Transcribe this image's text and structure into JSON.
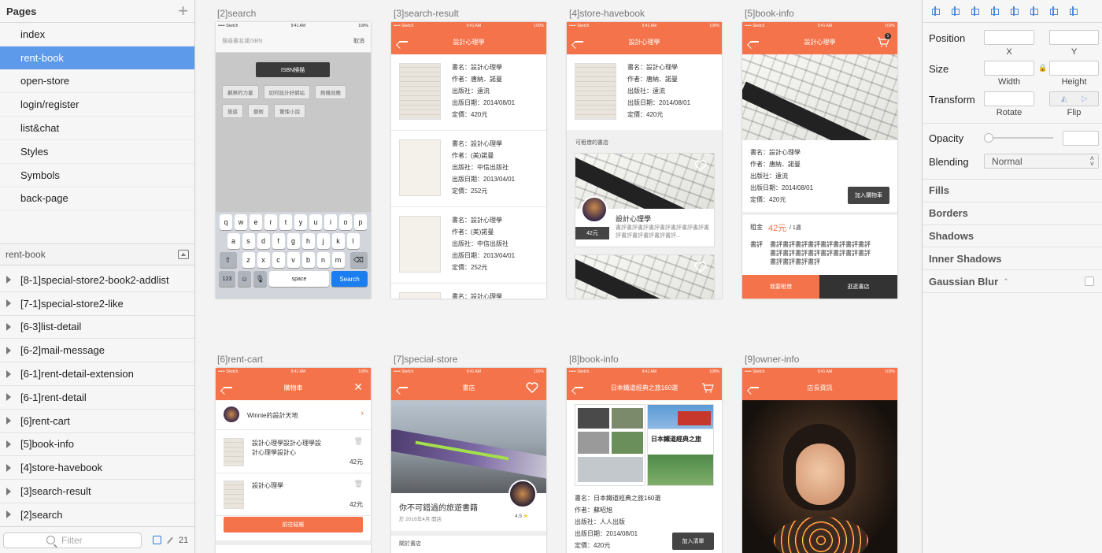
{
  "left": {
    "pages_title": "Pages",
    "pages": [
      "index",
      "rent-book",
      "open-store",
      "login/register",
      "list&chat",
      "Styles",
      "Symbols",
      "back-page"
    ],
    "selected_page": 1,
    "layer_header": "rent-book",
    "layers": [
      "[8-1]special-store2-book2-addlist",
      "[7-1]special-store2-like",
      "[6-3]list-detail",
      "[6-2]mail-message",
      "[6-1]rent-detail-extension",
      "[6-1]rent-detail",
      "[6]rent-cart",
      "[5]book-info",
      "[4]store-havebook",
      "[3]search-result",
      "[2]search"
    ],
    "filter_placeholder": "Filter",
    "count": "21"
  },
  "artboards": {
    "search": {
      "label": "[2]search",
      "status": [
        "•••••  Sketch",
        "9:41 AM",
        "100%"
      ],
      "placeholder": "搜尋書名或ISBN",
      "cancel": "取消",
      "isbn_btn": "ISBN掃描",
      "tags": [
        "觀察的力量",
        "如何設計好網站",
        "夠機效應",
        "旅遊",
        "藝術",
        "驚悚小說"
      ],
      "keys_row1": [
        "q",
        "w",
        "e",
        "r",
        "t",
        "y",
        "u",
        "i",
        "o",
        "p"
      ],
      "keys_row2": [
        "a",
        "s",
        "d",
        "f",
        "g",
        "h",
        "j",
        "k",
        "l"
      ],
      "keys_row3": [
        "z",
        "x",
        "c",
        "v",
        "b",
        "n",
        "m"
      ],
      "key_123": "123",
      "key_space": "space",
      "key_search": "Search"
    },
    "search_result": {
      "label": "[3]search-result",
      "status": [
        "•••••  Sketch",
        "9:41 AM",
        "100%"
      ],
      "title": "設計心理學",
      "items": [
        {
          "l1": "書名：設計心理學",
          "l2": "作者：唐納．諾曼",
          "l3": "出版社：遠流",
          "l4": "出版日期：2014/08/01",
          "l5": "定價：420元"
        },
        {
          "l1": "書名：設計心理學",
          "l2": "作者：(美)諾曼",
          "l3": "出版社：中信出版社",
          "l4": "出版日期：2013/04/01",
          "l5": "定價：252元"
        },
        {
          "l1": "書名：設計心理學",
          "l2": "作者：(美)諾曼",
          "l3": "出版社：中信出版社",
          "l4": "出版日期：2013/04/01",
          "l5": "定價：252元"
        },
        {
          "l1": "書名：設計心理學"
        }
      ]
    },
    "store_havebook": {
      "label": "[4]store-havebook",
      "status": [
        "•••••  Sketch",
        "9:41 AM",
        "100%"
      ],
      "title": "設計心理學",
      "book": {
        "l1": "書名：設計心理學",
        "l2": "作者：唐納．諾曼",
        "l3": "出版社：遠流",
        "l4": "出版日期：2014/08/01",
        "l5": "定價：420元"
      },
      "section": "可租借的書店",
      "card_title": "設計心理學",
      "card_desc": "書評書評書評書評書評書評書評書評書評書評書評書評書評書評...",
      "price": "42元"
    },
    "book_info": {
      "label": "[5]book-info",
      "status": [
        "•••••  Sketch",
        "9:41 AM",
        "100%"
      ],
      "title": "設計心理學",
      "cart_count": "1",
      "book": {
        "l1": "書名：設計心理學",
        "l2": "作者：唐納．諾曼",
        "l3": "出版社：遠流",
        "l4": "出版日期：2014/08/01",
        "l5": "定價：420元"
      },
      "add_cart": "加入購物車",
      "rent_label": "租金",
      "rent_price": "42元",
      "rent_unit": "/ 1週",
      "review_label": "書評",
      "review": "書評書評書評書評書評書評書評書評書評書評書評書評書評書評書評書評書評書評書評書評",
      "btn_rent": "我要租借",
      "btn_store": "逛逛書店"
    },
    "rent_cart": {
      "label": "[6]rent-cart",
      "status": [
        "•••••  Sketch",
        "9:41 AM",
        "100%"
      ],
      "title": "購物車",
      "store": "Winnie的設計天地",
      "items": [
        {
          "name": "設計心理學設計心理學設計心理學設計心",
          "price": "42元"
        },
        {
          "name": "設計心理學",
          "price": "42元"
        }
      ],
      "checkout": "前往結帳"
    },
    "special_store": {
      "label": "[7]special-store",
      "status": [
        "•••••  Sketch",
        "9:41 AM",
        "100%"
      ],
      "title": "書店",
      "store_name": "你不可錯過的旅遊書籍",
      "opened": "於 2016年4月 開店",
      "rating": "4.5",
      "about": "關於書店"
    },
    "book_info8": {
      "label": "[8]book-info",
      "status": [
        "•••••  Sketch",
        "9:41 AM",
        "100%"
      ],
      "title": "日本鐵道經典之旅160選",
      "cover_title": "日本鐵道經典之旅",
      "book": {
        "l1": "書名：日本鐵道經典之旅160選",
        "l2": "作者：蘇昭旭",
        "l3": "出版社：人人出版",
        "l4": "出版日期：2014/08/01",
        "l5": "定價：420元"
      },
      "add_list": "加入清單"
    },
    "owner_info": {
      "label": "[9]owner-info",
      "status": [
        "•••••  Sketch",
        "9:41 AM",
        "100%"
      ],
      "title": "店長資訊"
    }
  },
  "inspector": {
    "position": "Position",
    "x": "X",
    "y": "Y",
    "size": "Size",
    "width": "Width",
    "height": "Height",
    "transform": "Transform",
    "rotate": "Rotate",
    "flip": "Flip",
    "opacity": "Opacity",
    "blending": "Blending",
    "blending_value": "Normal",
    "sections": [
      "Fills",
      "Borders",
      "Shadows",
      "Inner Shadows",
      "Gaussian Blur"
    ]
  },
  "colors": {
    "accent": "#f5734a",
    "selection": "#5d9bea",
    "dark_button": "#444444",
    "ios_blue": "#1a7ef0"
  }
}
